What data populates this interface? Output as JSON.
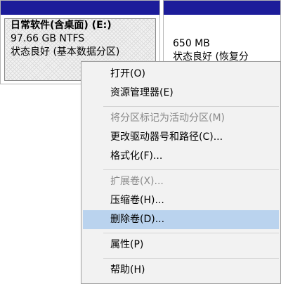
{
  "volumes": {
    "e": {
      "name": "日常软件(含桌面) (E:)",
      "size": "97.66 GB NTFS",
      "status": "状态良好 (基本数据分区)"
    },
    "recovery": {
      "size": "650 MB",
      "status": "状态良好 (恢复分"
    }
  },
  "menu": {
    "items": [
      {
        "label": "打开(O)",
        "enabled": true
      },
      {
        "label": "资源管理器(E)",
        "enabled": true
      },
      {
        "label": "将分区标记为活动分区(M)",
        "enabled": false
      },
      {
        "label": "更改驱动器号和路径(C)...",
        "enabled": true
      },
      {
        "label": "格式化(F)...",
        "enabled": true
      },
      {
        "label": "扩展卷(X)...",
        "enabled": false
      },
      {
        "label": "压缩卷(H)...",
        "enabled": true
      },
      {
        "label": "删除卷(D)...",
        "enabled": true,
        "highlighted": true
      },
      {
        "label": "属性(P)",
        "enabled": true
      },
      {
        "label": "帮助(H)",
        "enabled": true
      }
    ]
  },
  "colors": {
    "volume_header": "#1c1c9a",
    "menu_background": "#f2f2f2",
    "menu_highlight": "#bad3ee",
    "disabled_text": "#8a8a8a"
  }
}
